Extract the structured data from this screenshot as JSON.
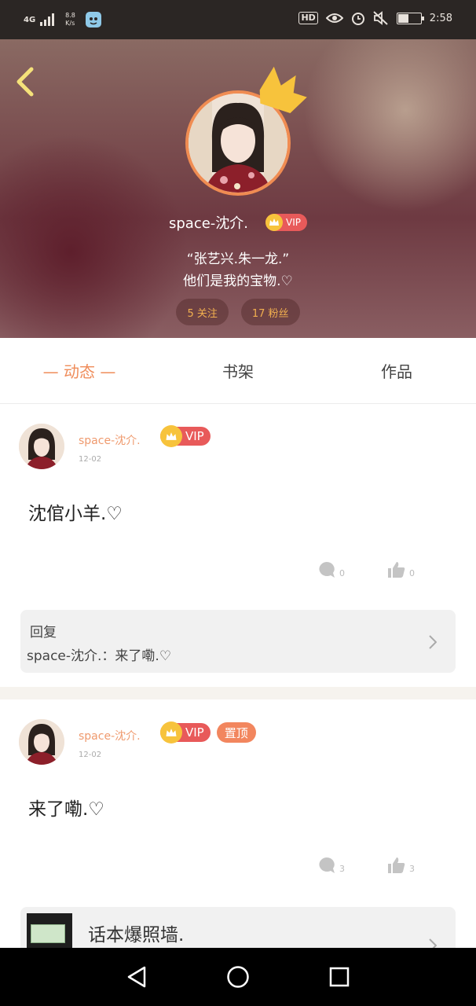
{
  "status_bar": {
    "network": "4G",
    "speed_value": "8.8",
    "speed_unit": "K/s",
    "hd_label": "HD",
    "time": "2:58",
    "battery_level": 0.45
  },
  "profile": {
    "name": "space-沈介.",
    "vip_label": "VIP",
    "quote_line1": "“张艺兴.朱一龙.”",
    "quote_line2": "他们是我的宝物.♡",
    "following": "5 关注",
    "fans": "17 粉丝"
  },
  "tabs": [
    {
      "label": "— 动态 —",
      "active": true
    },
    {
      "label": "书架",
      "active": false
    },
    {
      "label": "作品",
      "active": false
    }
  ],
  "posts": [
    {
      "author": "space-沈介.",
      "vip_label": "VIP",
      "date": "12-02",
      "text": "沈倌小羊.♡",
      "comments": "0",
      "likes": "0",
      "reply": {
        "title": "回复",
        "text": "space-沈介.：来了嘞.♡"
      }
    },
    {
      "author": "space-沈介.",
      "vip_label": "VIP",
      "pin_label": "置顶",
      "date": "12-02",
      "text": "来了嘞.♡",
      "comments": "3",
      "likes": "3",
      "link": {
        "title": "话本爆照墙."
      }
    }
  ],
  "colors": {
    "accent": "#ef8c5a",
    "vip_red": "#e85a5a",
    "crown_gold": "#f7c33c",
    "pin": "#f2865e"
  }
}
